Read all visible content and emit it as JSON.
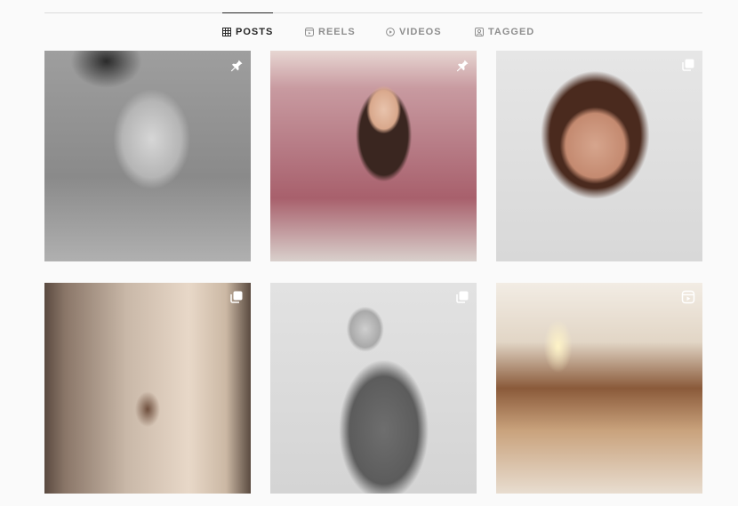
{
  "profile_tabs": [
    {
      "label": "POSTS",
      "icon": "grid-icon",
      "active": true
    },
    {
      "label": "REELS",
      "icon": "reels-icon",
      "active": false
    },
    {
      "label": "VIDEOS",
      "icon": "video-icon",
      "active": false
    },
    {
      "label": "TAGGED",
      "icon": "tagged-icon",
      "active": false
    }
  ],
  "posts": [
    {
      "name": "post-laughing-portrait",
      "badge": "pin-icon"
    },
    {
      "name": "post-selfie-hotel-room",
      "badge": "pin-icon"
    },
    {
      "name": "post-freckled-selfie",
      "badge": "carousel-icon"
    },
    {
      "name": "post-mirror-selfie",
      "badge": "carousel-icon"
    },
    {
      "name": "post-black-white-portrait",
      "badge": "carousel-icon"
    },
    {
      "name": "post-restaurant-interior",
      "badge": "reel-icon"
    }
  ],
  "colors": {
    "active_tab": "#262626",
    "inactive_tab": "#8e8e8e",
    "background": "#fafafa"
  }
}
